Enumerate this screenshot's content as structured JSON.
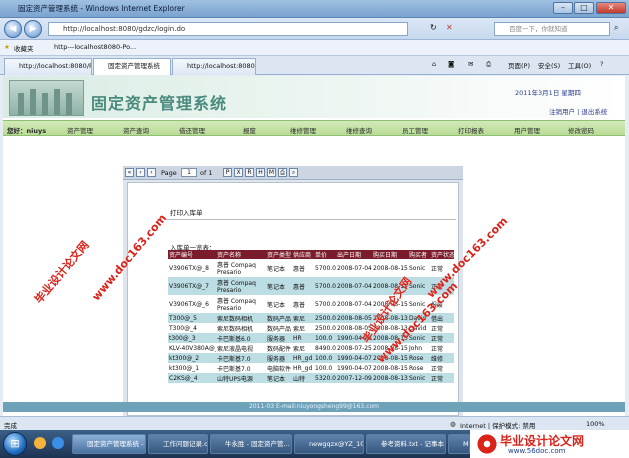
{
  "window": {
    "title": "固定资产管理系统 - Windows Internet Explorer"
  },
  "browser": {
    "address": "http://localhost:8080/gdzc/login.do",
    "search_placeholder": "百度一下，你就知道",
    "favorites_label": "收藏夹",
    "fav_link": "http---localhost8080-Po...",
    "tabs": [
      {
        "label": "http://localhost:8080/Po..."
      },
      {
        "label": "固定资产管理系统"
      },
      {
        "label": "http://localhost:8080/Po..."
      }
    ],
    "cmd_page": "页面(P)",
    "cmd_safety": "安全(S)",
    "cmd_tools": "工具(O)"
  },
  "app": {
    "title": "固定资产管理系统",
    "date": "2011年3月1日   星期四",
    "top_links": "注销用户 | 退出系统",
    "welcome": "您好：niuys",
    "menu": [
      "资产管理",
      "资产查询",
      "借还管理",
      "报废",
      "维修管理",
      "维修查询",
      "员工管理",
      "打印报表",
      "用户管理",
      "修改密码"
    ],
    "footer": "2011-03 E-mail:niuyongsheng99@163.com"
  },
  "report": {
    "page_label": "Page",
    "page_num": "1",
    "of_label": "of 1",
    "doc_title": "打印入库单",
    "list_title": "入库单一览表：",
    "headers": [
      "资产编号",
      "资产名称",
      "资产类型",
      "供应商",
      "单价",
      "出产日期",
      "购买日期",
      "购买者",
      "资产状态"
    ],
    "rows": [
      [
        "V3906TX@_8",
        "惠普 Compaq Presario",
        "笔记本",
        "惠普",
        "5700.0",
        "2008-07-04",
        "2008-08-15",
        "Sonic",
        "正常"
      ],
      [
        "V3906TX@_7",
        "惠普 Compaq Presario",
        "笔记本",
        "惠普",
        "5700.0",
        "2008-07-04",
        "2008-08-15",
        "Sonic",
        "正常"
      ],
      [
        "V3906TX@_6",
        "惠普 Compaq Presario",
        "笔记本",
        "惠普",
        "5700.0",
        "2008-07-04",
        "2008-08-15",
        "Sonic",
        "报废"
      ],
      [
        "T300@_5",
        "索尼数码相机",
        "数码产品",
        "索尼",
        "2500.0",
        "2008-08-05",
        "2008-08-13",
        "David",
        "借出"
      ],
      [
        "T300@_4",
        "索尼数码相机",
        "数码产品",
        "索尼",
        "2500.0",
        "2008-08-05",
        "2008-08-13",
        "David",
        "正常"
      ],
      [
        "t300@_3",
        "卡巴斯基6.0",
        "服务器",
        "HR",
        "100.0",
        "1990-04-08",
        "2008-08-15",
        "Sonic",
        "正常"
      ],
      [
        "KLV-40V380A@_5",
        "索尼液晶电视",
        "数码配件",
        "索尼",
        "8490.0",
        "2008-07-25",
        "2008-08-15",
        "John",
        "正常"
      ],
      [
        "kt300@_2",
        "卡巴斯基7.0",
        "服务器",
        "HR_gd",
        "100.0",
        "1990-04-07",
        "2008-08-15",
        "Rose",
        "维修"
      ],
      [
        "kt300@_1",
        "卡巴斯基7.0",
        "电脑软件",
        "HR_gd",
        "100.0",
        "1990-04-07",
        "2008-08-15",
        "Rose",
        "正常"
      ],
      [
        "C2KS@_4",
        "山特UPS电源",
        "笔记本",
        "山特",
        "5320.0",
        "2007-12-09",
        "2008-08-13",
        "Sonic",
        "正常"
      ]
    ]
  },
  "watermark": {
    "text1": "毕业设计论文网",
    "text2": "www.doc163.com",
    "site": "www.56doc.com"
  },
  "status": {
    "left": "完成",
    "zone": "Internet | 保护模式: 禁用",
    "zoom": "100%"
  },
  "taskbar": {
    "items": [
      "固定资产管理系统 - ...",
      "工作问题记录.docx ...",
      "牛永胜 - 固定资产管...",
      "newgqzx@YZ_10.2...",
      "参考资料.txt - 记事本",
      "My..."
    ]
  }
}
